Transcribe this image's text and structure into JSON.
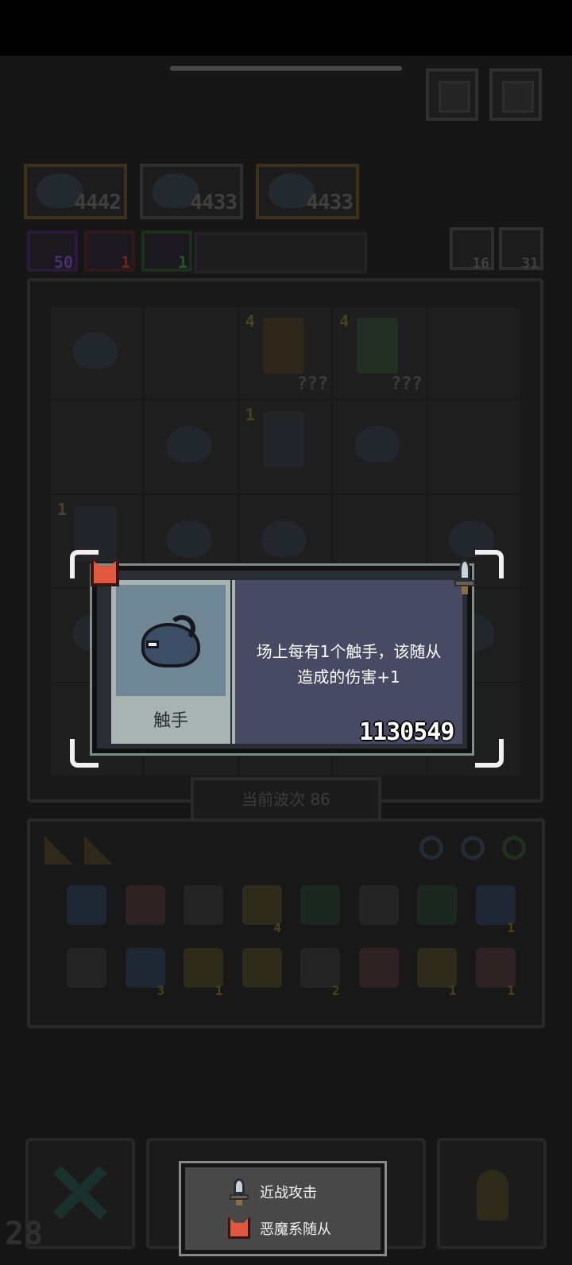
{
  "top_cards": [
    {
      "value": "4442"
    },
    {
      "value": "4433"
    },
    {
      "value": "4433"
    }
  ],
  "stats": [
    {
      "value": "50",
      "color": "#5a3a8a"
    },
    {
      "value": "1",
      "color": "#8a2a22"
    },
    {
      "value": "1",
      "color": "#2a6a2a"
    }
  ],
  "right_counts": [
    {
      "value": "16"
    },
    {
      "value": "31"
    }
  ],
  "board": {
    "hero_labels": [
      "???",
      "???"
    ],
    "levels": [
      "4",
      "4",
      "1",
      "1"
    ]
  },
  "wave": {
    "label": "当前波次 86"
  },
  "inventory": {
    "item_counts": [
      "4",
      "1",
      "3",
      "1",
      "2",
      "1",
      "1"
    ]
  },
  "bottom": {
    "counter": "28"
  },
  "popup": {
    "unit_name": "触手",
    "description_line1": "场上每有1个触手，该随从",
    "description_line2": "造成的伤害+1",
    "score": "1130549",
    "type_icon": "demon-icon",
    "attack_icon": "dagger-icon"
  },
  "legend": {
    "items": [
      {
        "icon": "dagger-icon",
        "label": "近战攻击"
      },
      {
        "icon": "demon-icon",
        "label": "恶魔系随从"
      }
    ]
  },
  "colors": {
    "popup_description_bg": "#474a62",
    "popup_image_bg": "#6f8794",
    "demon_red": "#e0593e"
  }
}
